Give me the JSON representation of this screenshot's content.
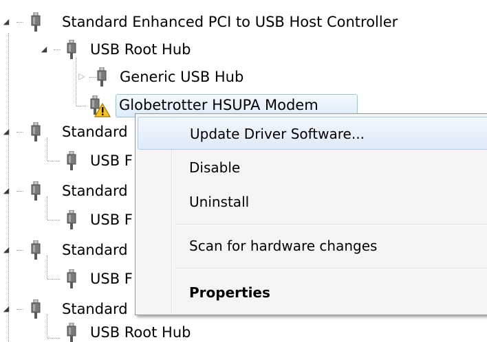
{
  "tree": {
    "rows": [
      {
        "label": "Standard Enhanced PCI to USB Host Controller",
        "expander": "◢"
      },
      {
        "label": "USB Root Hub",
        "expander": "◢"
      },
      {
        "label": "Generic USB Hub",
        "expander": "▷"
      },
      {
        "label": "Globetrotter HSUPA Modem",
        "expander": ""
      },
      {
        "label": "Standard",
        "expander": "◢"
      },
      {
        "label": "USB F",
        "expander": ""
      },
      {
        "label": "Standard",
        "expander": "◢"
      },
      {
        "label": "USB F",
        "expander": ""
      },
      {
        "label": "Standard",
        "expander": "◢"
      },
      {
        "label": "USB F",
        "expander": ""
      },
      {
        "label": "Standard",
        "expander": "◢"
      },
      {
        "label": "USB Root Hub",
        "expander": ""
      }
    ]
  },
  "context_menu": {
    "items": [
      {
        "label": "Update Driver Software..."
      },
      {
        "label": "Disable"
      },
      {
        "label": "Uninstall"
      },
      {
        "label": "Scan for hardware changes"
      },
      {
        "label": "Properties"
      }
    ]
  },
  "icons": {
    "device": "usb-plug-icon",
    "warning": "warning-icon"
  },
  "colors": {
    "selection_border": "#8fc3ea",
    "menu_hover_border": "#aeccf0",
    "menu_background": "#f5f5f5",
    "warning_yellow": "#f7c21b"
  }
}
